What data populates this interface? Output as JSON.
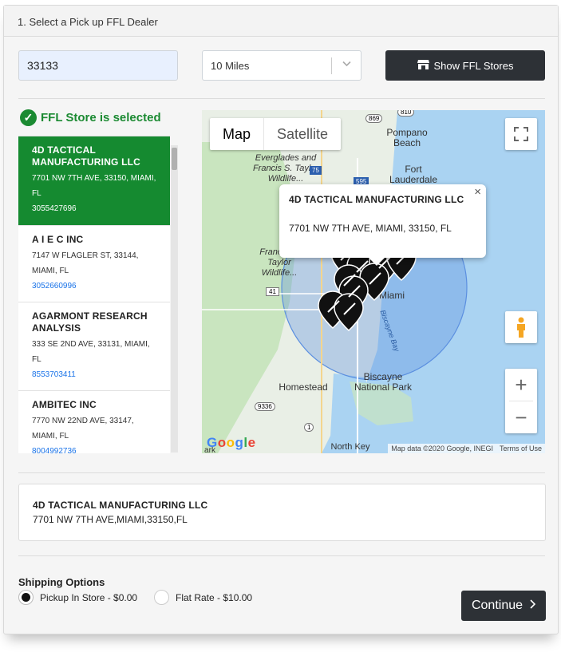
{
  "header": {
    "title": "1. Select a Pick up FFL Dealer"
  },
  "search": {
    "zip_value": "33133",
    "radius_selected": "10 Miles",
    "show_button": "Show FFL Stores"
  },
  "status": {
    "selected_text": "FFL Store is selected"
  },
  "stores": [
    {
      "name": "4D TACTICAL MANUFACTURING LLC",
      "address": "7701 NW 7TH AVE, 33150, MIAMI, FL",
      "phone": "3055427696"
    },
    {
      "name": "A I E C INC",
      "address": "7147 W FLAGLER ST, 33144, MIAMI, FL",
      "phone": "3052660996"
    },
    {
      "name": "AGARMONT RESEARCH ANALYSIS",
      "address": "333 SE 2ND AVE, 33131, MIAMI, FL",
      "phone": "8553703411"
    },
    {
      "name": "AMBITEC INC",
      "address": "7770 NW 22ND AVE, 33147, MIAMI, FL",
      "phone": "8004992736"
    }
  ],
  "map": {
    "tabs": [
      "Map",
      "Satellite"
    ],
    "info_name": "4D TACTICAL MANUFACTURING LLC",
    "info_address": "7701 NW 7TH AVE, MIAMI, 33150, FL",
    "labels": {
      "pompano": "Pompano Beach",
      "everglades": "Everglades and Francis S. Taylor Wildlife...",
      "fort": "Fort Lauderdale",
      "francis": "Francis S. Taylor Wildlife...",
      "miami": "Miami",
      "biscayne_bay": "Biscayne Bay",
      "biscayne_park": "Biscayne National Park",
      "homestead": "Homestead",
      "north_key": "North Key",
      "park": "ark",
      "road_810": "810",
      "road_869": "869",
      "road_75": "75",
      "road_595": "595",
      "road_41": "41",
      "road_9336": "9336",
      "road_1": "1"
    },
    "attribution": "Map data ©2020 Google, INEGI",
    "terms": "Terms of Use",
    "logo": "Google",
    "colors": {
      "land": "#e9efe6",
      "water": "#aad3f2",
      "park": "#c9e5bf",
      "radius": "#5b8fe0"
    }
  },
  "selection": {
    "name": "4D TACTICAL MANUFACTURING LLC",
    "address": "7701 NW 7TH AVE,MIAMI,33150,FL"
  },
  "shipping": {
    "title": "Shipping Options",
    "options": [
      {
        "label": "Pickup In Store - $0.00",
        "selected": true
      },
      {
        "label": "Flat Rate - $10.00",
        "selected": false
      }
    ]
  },
  "continue_label": "Continue",
  "colors": {
    "accent_green": "#158a30",
    "dark_button": "#2d3136",
    "link_blue": "#1a73e8"
  }
}
